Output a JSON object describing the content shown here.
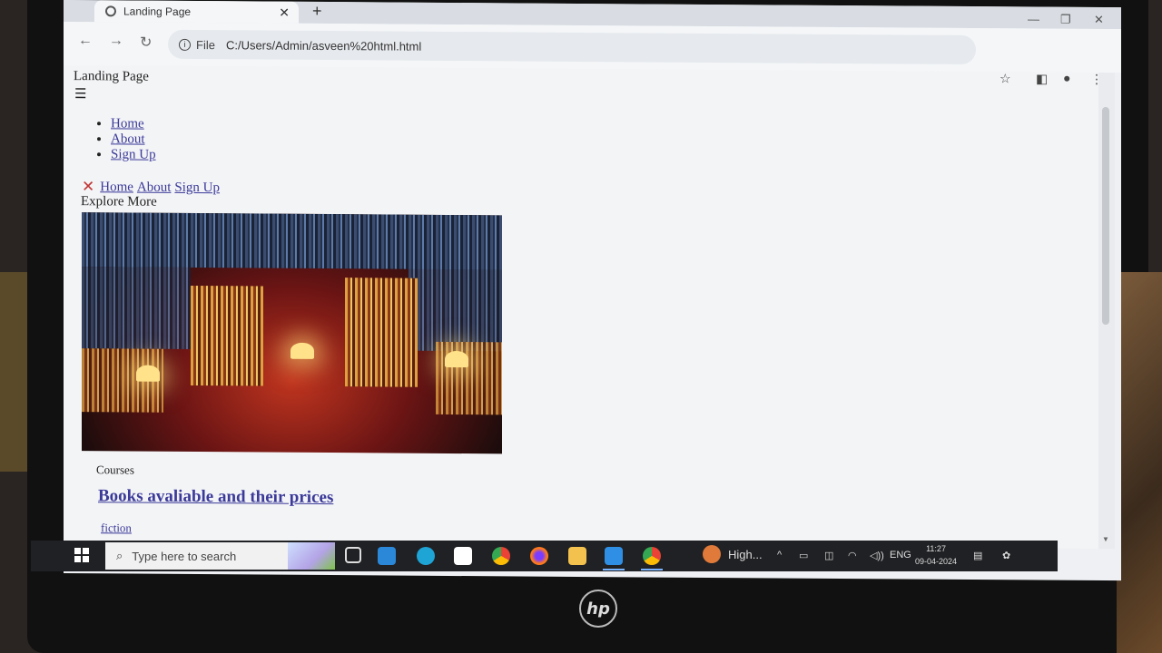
{
  "browser": {
    "tab_title": "Landing Page",
    "new_tab": "+",
    "tab_close": "✕",
    "url_scheme": "File",
    "url": "C:/Users/Admin/asveen%20html.html"
  },
  "page": {
    "brand": "Landing Page",
    "hamburger": "☰",
    "menu": [
      "Home",
      "About",
      "Sign Up"
    ],
    "close_x": "✕",
    "nav": [
      "Home",
      "About",
      "Sign Up"
    ],
    "explore": "Explore More",
    "courses": "Courses",
    "books_heading": "Books avaliable and their prices",
    "fiction": "fiction"
  },
  "taskbar": {
    "search_placeholder": "Type here to search",
    "highlight_app": "High...",
    "language": "ENG",
    "time": "11:27",
    "date": "09-04-2024"
  },
  "device": {
    "logo": "hp"
  }
}
